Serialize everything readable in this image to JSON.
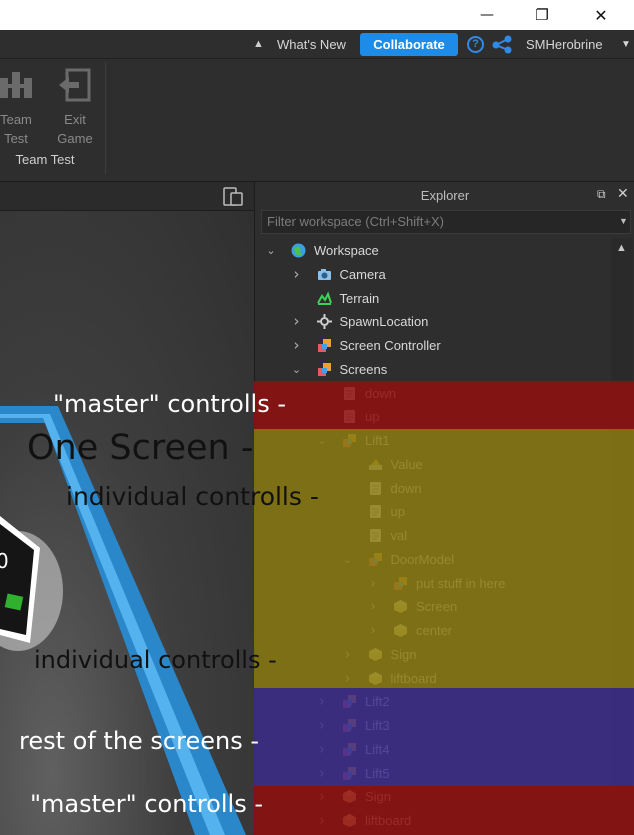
{
  "titlebar": {
    "minimize": "—",
    "maximize": "❐",
    "close": "✕"
  },
  "topbar": {
    "whats_new": "What's New",
    "collaborate": "Collaborate",
    "help": "?",
    "user": "SMHerobrine"
  },
  "ribbon": {
    "team_test_label": "Team\nTest",
    "exit_game_label": "Exit\nGame",
    "group_label": "Team Test"
  },
  "explorer": {
    "title": "Explorer",
    "filter_placeholder": "Filter workspace (Ctrl+Shift+X)",
    "rows": [
      {
        "label": "Workspace",
        "icon": "globe-icon",
        "chevron": "down"
      },
      {
        "label": "Camera",
        "icon": "camera-icon",
        "chevron": "right"
      },
      {
        "label": "Terrain",
        "icon": "terrain-icon",
        "chevron": "none"
      },
      {
        "label": "SpawnLocation",
        "icon": "spawn-icon",
        "chevron": "right"
      },
      {
        "label": "Screen Controller",
        "icon": "model-icon",
        "chevron": "right"
      },
      {
        "label": "Screens",
        "icon": "model-icon",
        "chevron": "down"
      },
      {
        "label": "down",
        "icon": "script-icon",
        "chevron": "none"
      },
      {
        "label": "up",
        "icon": "script-icon",
        "chevron": "none"
      },
      {
        "label": "Lift1",
        "icon": "model-icon",
        "chevron": "down"
      },
      {
        "label": "Value",
        "icon": "value-icon",
        "chevron": "none"
      },
      {
        "label": "down",
        "icon": "script-icon",
        "chevron": "none"
      },
      {
        "label": "up",
        "icon": "script-icon",
        "chevron": "none"
      },
      {
        "label": "val",
        "icon": "script-icon",
        "chevron": "none"
      },
      {
        "label": "DoorModel",
        "icon": "model-icon",
        "chevron": "down"
      },
      {
        "label": "put stuff in here",
        "icon": "model-icon",
        "chevron": "right"
      },
      {
        "label": "Screen",
        "icon": "part-icon",
        "chevron": "right"
      },
      {
        "label": "center",
        "icon": "part-icon",
        "chevron": "right"
      },
      {
        "label": "Sign",
        "icon": "part-icon",
        "chevron": "right"
      },
      {
        "label": "liftboard",
        "icon": "part-icon",
        "chevron": "right"
      },
      {
        "label": "Lift2",
        "icon": "model-icon",
        "chevron": "right"
      },
      {
        "label": "Lift3",
        "icon": "model-icon",
        "chevron": "right"
      },
      {
        "label": "Lift4",
        "icon": "model-icon",
        "chevron": "right"
      },
      {
        "label": "Lift5",
        "icon": "model-icon",
        "chevron": "right"
      },
      {
        "label": "Sign",
        "icon": "part-icon",
        "chevron": "right"
      },
      {
        "label": "liftboard",
        "icon": "part-icon",
        "chevron": "right"
      }
    ]
  },
  "annotations": {
    "master_top": "\"master\" controlls -",
    "one_screen": "One Screen -",
    "individual_1": "individual controlls -",
    "individual_2": "individual controlls -",
    "rest": "rest of the screens -",
    "master_bottom": "\"master\" controlls -"
  },
  "viewport": {
    "screen_text": "0"
  },
  "colors": {
    "red_band": "#8e1111",
    "yellow_band": "#8a7a10",
    "blue_band": "#3c2d8c",
    "collaborate": "#1e8ce6",
    "accent_blue": "#2f8ae8"
  }
}
